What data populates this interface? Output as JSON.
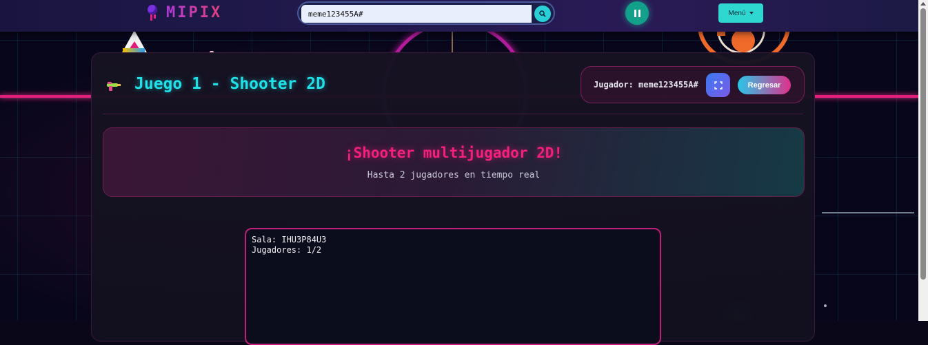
{
  "navbar": {
    "logo_text": "MIPIX",
    "search": {
      "value": "meme123455A#",
      "placeholder": ""
    },
    "menu_label": "Menú"
  },
  "game": {
    "title": "Juego 1 - Shooter 2D",
    "player_label": "Jugador: meme123455A#",
    "back_label": "Regresar"
  },
  "banner": {
    "title": "¡Shooter multijugador 2D!",
    "subtitle": "Hasta 2 jugadores en tiempo real"
  },
  "room": {
    "sala": "Sala: IHU3P84U3",
    "jugadores": "Jugadores: 1/2"
  },
  "icons": {
    "logo": "pixel-balloon-icon",
    "search": "search-icon",
    "pause": "pause-icon",
    "menu_caret": "caret-down-icon",
    "game": "water-gun-icon",
    "fullscreen": "fullscreen-icon"
  },
  "colors": {
    "accent_cyan": "#20e0e8",
    "accent_pink": "#f5207e",
    "pause_green": "#12a08a",
    "background": "#07061a"
  }
}
